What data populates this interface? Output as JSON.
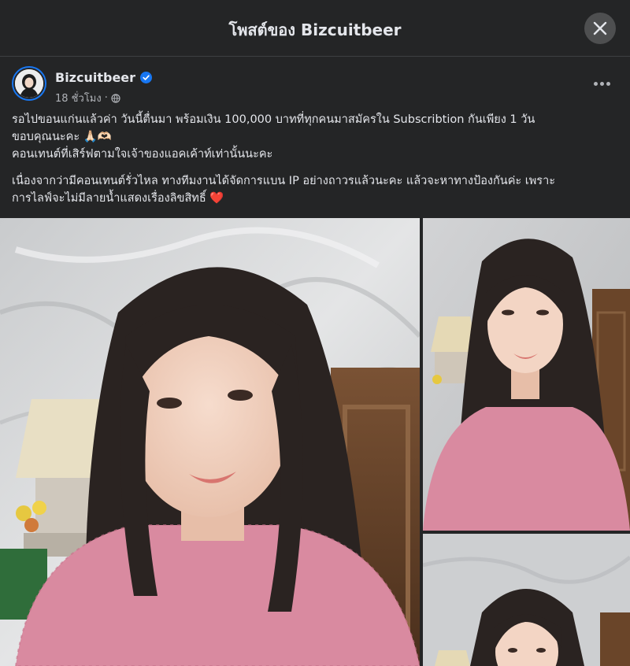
{
  "header": {
    "title": "โพสต์ของ Bizcuitbeer",
    "close_icon": "close-icon"
  },
  "post": {
    "author": "Bizcuitbeer",
    "verified_icon": "verified-badge-icon",
    "time": "18 ชั่วโมง",
    "separator": "·",
    "audience_icon": "globe-icon",
    "more_icon": "more-horizontal-icon",
    "lines": [
      "รอไปขอนแก่นแล้วค่า วันนี้ตื่นมา พร้อมเงิน 100,000 บาทที่ทุกคนมาสมัครใน Subscribtion กันเพียง 1 วัน",
      "ขอบคุณนะคะ 🙏🏻🫶🏻",
      "คอนเทนต์ที่เสิร์ฟตามใจเจ้าของแอคเค้าท์เท่านั้นนะคะ",
      "เนื่องจากว่ามีคอนเทนต์รั่วไหล ทางทีมงานได้จัดการแบน IP อย่างถาวรแล้วนะคะ แล้วจะหาทางป้องกันค่ะ เพราะ",
      "การไลฟ์จะไม่มีลายน้ำแสดงเรื่องลิขสิทธิ์ ❤️"
    ]
  },
  "photos": [
    {
      "name": "photo-main"
    },
    {
      "name": "photo-top-right"
    },
    {
      "name": "photo-bottom-right"
    }
  ],
  "colors": {
    "background": "#242526",
    "text": "#e4e6eb",
    "secondary_text": "#b0b3b8",
    "verified": "#1877f2"
  }
}
